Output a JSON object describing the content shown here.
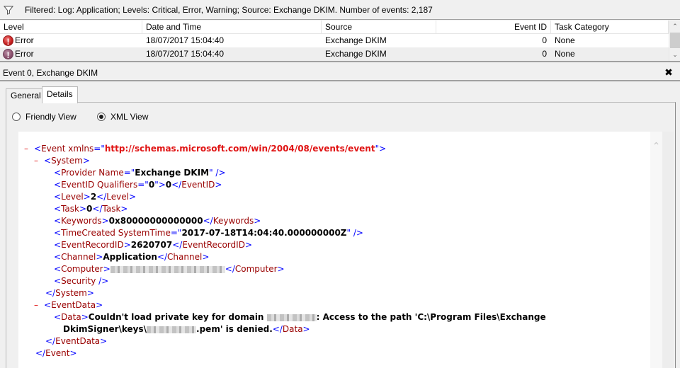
{
  "filter_bar": {
    "icon": "filter-funnel-icon",
    "text": "Filtered: Log: Application; Levels: Critical, Error, Warning; Source: Exchange DKIM. Number of events: 2,187"
  },
  "event_grid": {
    "columns": [
      "Level",
      "Date and Time",
      "Source",
      "Event ID",
      "Task Category"
    ],
    "rows": [
      {
        "level": "Error",
        "level_icon": "error-icon",
        "datetime": "18/07/2017 15:04:40",
        "source": "Exchange DKIM",
        "event_id": "0",
        "task_category": "None"
      },
      {
        "level": "Error",
        "level_icon": "error-icon",
        "datetime": "18/07/2017 15:04:40",
        "source": "Exchange DKIM",
        "event_id": "0",
        "task_category": "None"
      }
    ]
  },
  "detail": {
    "title": "Event 0, Exchange DKIM",
    "close_icon": "close-icon",
    "tabs": [
      {
        "label": "General",
        "active": false
      },
      {
        "label": "Details",
        "active": true
      }
    ],
    "view_options": [
      {
        "label": "Friendly View",
        "selected": false
      },
      {
        "label": "XML View",
        "selected": true
      }
    ]
  },
  "xml": {
    "event_tag": "Event",
    "xmlns_attr": "xmlns",
    "xmlns_value": "http://schemas.microsoft.com/win/2004/08/events/event",
    "system_tag": "System",
    "provider": {
      "tag": "Provider",
      "attr": "Name",
      "value": "Exchange DKIM"
    },
    "event_id": {
      "tag": "EventID",
      "attr": "Qualifiers",
      "attr_value": "0",
      "value": "0"
    },
    "level": {
      "tag": "Level",
      "value": "2"
    },
    "task": {
      "tag": "Task",
      "value": "0"
    },
    "keywords": {
      "tag": "Keywords",
      "value": "0x80000000000000"
    },
    "time_created": {
      "tag": "TimeCreated",
      "attr": "SystemTime",
      "value": "2017-07-18T14:04:40.000000000Z"
    },
    "event_record_id": {
      "tag": "EventRecordID",
      "value": "2620707"
    },
    "channel": {
      "tag": "Channel",
      "value": "Application"
    },
    "computer": {
      "tag": "Computer",
      "value_redacted": true
    },
    "security": {
      "tag": "Security"
    },
    "event_data_tag": "EventData",
    "data": {
      "tag": "Data",
      "text_part1": "Couldn't load private key for domain ",
      "text_part2": ": Access to the path 'C:\\Program Files\\Exchange",
      "text_part3": "DkimSigner\\keys\\",
      "text_part4": ".pem' is denied."
    }
  }
}
